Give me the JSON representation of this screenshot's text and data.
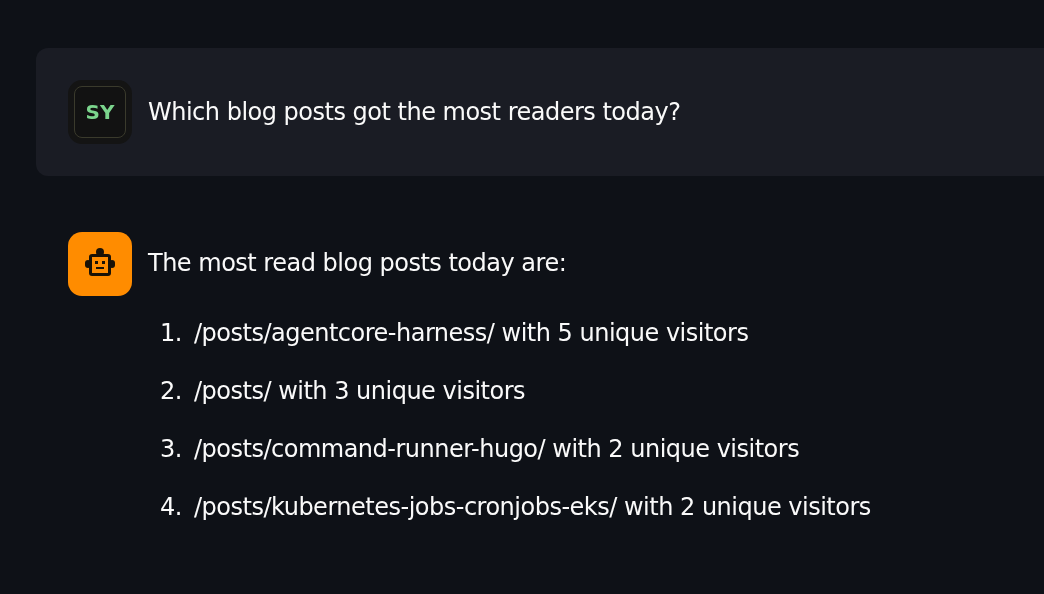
{
  "messages": [
    {
      "kind": "user",
      "avatar": "SY",
      "text": "Which blog posts got the most readers today?"
    },
    {
      "kind": "assistant",
      "text": "The most read blog posts today are:",
      "list": [
        {
          "number": "1.",
          "text": "/posts/agentcore-harness/ with 5 unique visitors"
        },
        {
          "number": "2.",
          "text": "/posts/ with 3 unique visitors"
        },
        {
          "number": "3.",
          "text": "/posts/command-runner-hugo/ with 2 unique visitors"
        },
        {
          "number": "4.",
          "text": "/posts/kubernetes-jobs-cronjobs-eks/ with 2 unique visitors"
        }
      ]
    }
  ]
}
